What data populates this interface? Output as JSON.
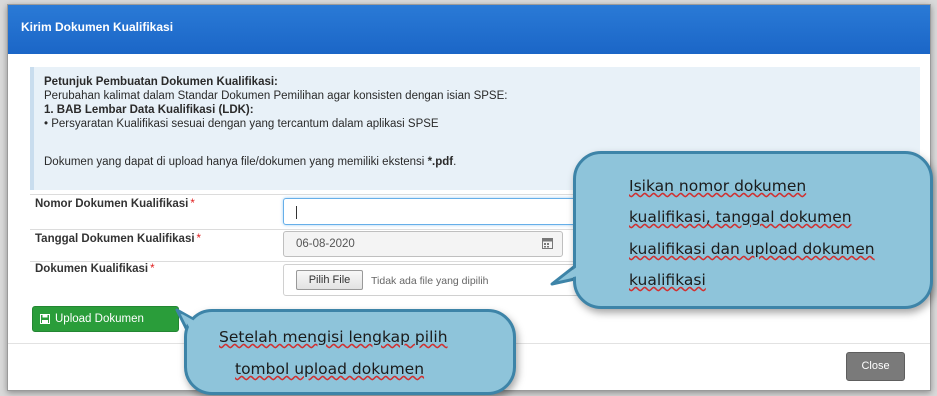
{
  "modal": {
    "title": "Kirim Dokumen Kualifikasi"
  },
  "info": {
    "heading": "Petunjuk Pembuatan Dokumen Kualifikasi:",
    "line1": "Perubahan kalimat dalam Standar Dokumen Pemilihan agar konsisten dengan isian SPSE:",
    "section": "1. BAB Lembar Data Kualifikasi (LDK):",
    "bullet": "• Persyaratan Kualifikasi sesuai dengan yang tercantum dalam aplikasi SPSE",
    "note_prefix": "Dokumen yang dapat di upload hanya file/dokumen yang memiliki ekstensi ",
    "note_ext": "*.pdf",
    "note_suffix": "."
  },
  "form": {
    "nomor_label": "Nomor Dokumen Kualifikasi",
    "nomor_value": "",
    "tanggal_label": "Tanggal Dokumen Kualifikasi",
    "tanggal_value": "06-08-2020",
    "dokumen_label": "Dokumen Kualifikasi",
    "file_button": "Pilih File",
    "file_status": "Tidak ada file yang dipilih",
    "required_mark": "*"
  },
  "buttons": {
    "upload": "Upload Dokumen",
    "close": "Close"
  },
  "callouts": {
    "right": [
      "Isikan nomor dokumen",
      "kualifikasi, tanggal dokumen",
      "kualifikasi dan upload dokumen",
      "kualifikasi"
    ],
    "bottom": [
      "Setelah mengisi lengkap pilih",
      "tombol upload dokumen"
    ]
  },
  "icons": {
    "calendar": "calendar-icon",
    "save": "save-icon"
  },
  "colors": {
    "header": "#1b66c7",
    "upload": "#2a9d3a",
    "callout_fill": "#8ec4da",
    "callout_border": "#3d84a8"
  }
}
